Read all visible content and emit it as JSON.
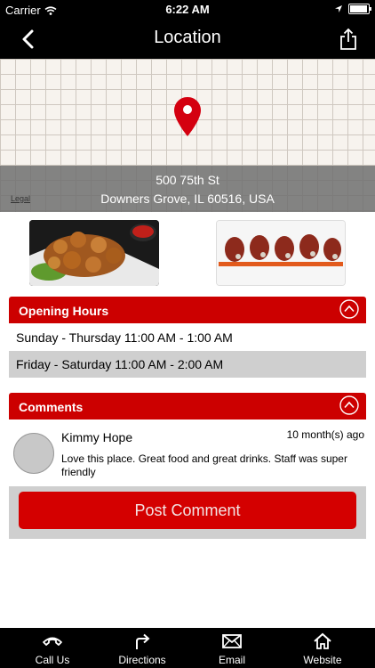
{
  "status_bar": {
    "carrier": "Carrier",
    "time": "6:22 AM"
  },
  "nav": {
    "title": "Location"
  },
  "map": {
    "address_line1": "500 75th St",
    "address_line2": "Downers Grove, IL 60516, USA",
    "legal": "Legal"
  },
  "photos": [
    {
      "icon": "food-photo-fried"
    },
    {
      "icon": "food-photo-plated"
    }
  ],
  "opening_hours": {
    "header": "Opening Hours",
    "rows": [
      {
        "text": "Sunday - Thursday 11:00 AM - 1:00 AM"
      },
      {
        "text": "Friday - Saturday 11:00 AM - 2:00 AM"
      }
    ]
  },
  "comments": {
    "header": "Comments",
    "items": [
      {
        "name": "Kimmy Hope",
        "age": "10 month(s) ago",
        "text": "Love this place.  Great food and great drinks.  Staff was super friendly"
      }
    ],
    "post_label": "Post Comment"
  },
  "tabs": [
    {
      "label": "Call Us",
      "icon": "phone-icon"
    },
    {
      "label": "Directions",
      "icon": "directions-icon"
    },
    {
      "label": "Email",
      "icon": "email-icon"
    },
    {
      "label": "Website",
      "icon": "home-icon"
    }
  ],
  "colors": {
    "accent": "#cc0000",
    "bar": "#000000",
    "row_alt": "#cfcfcf"
  }
}
